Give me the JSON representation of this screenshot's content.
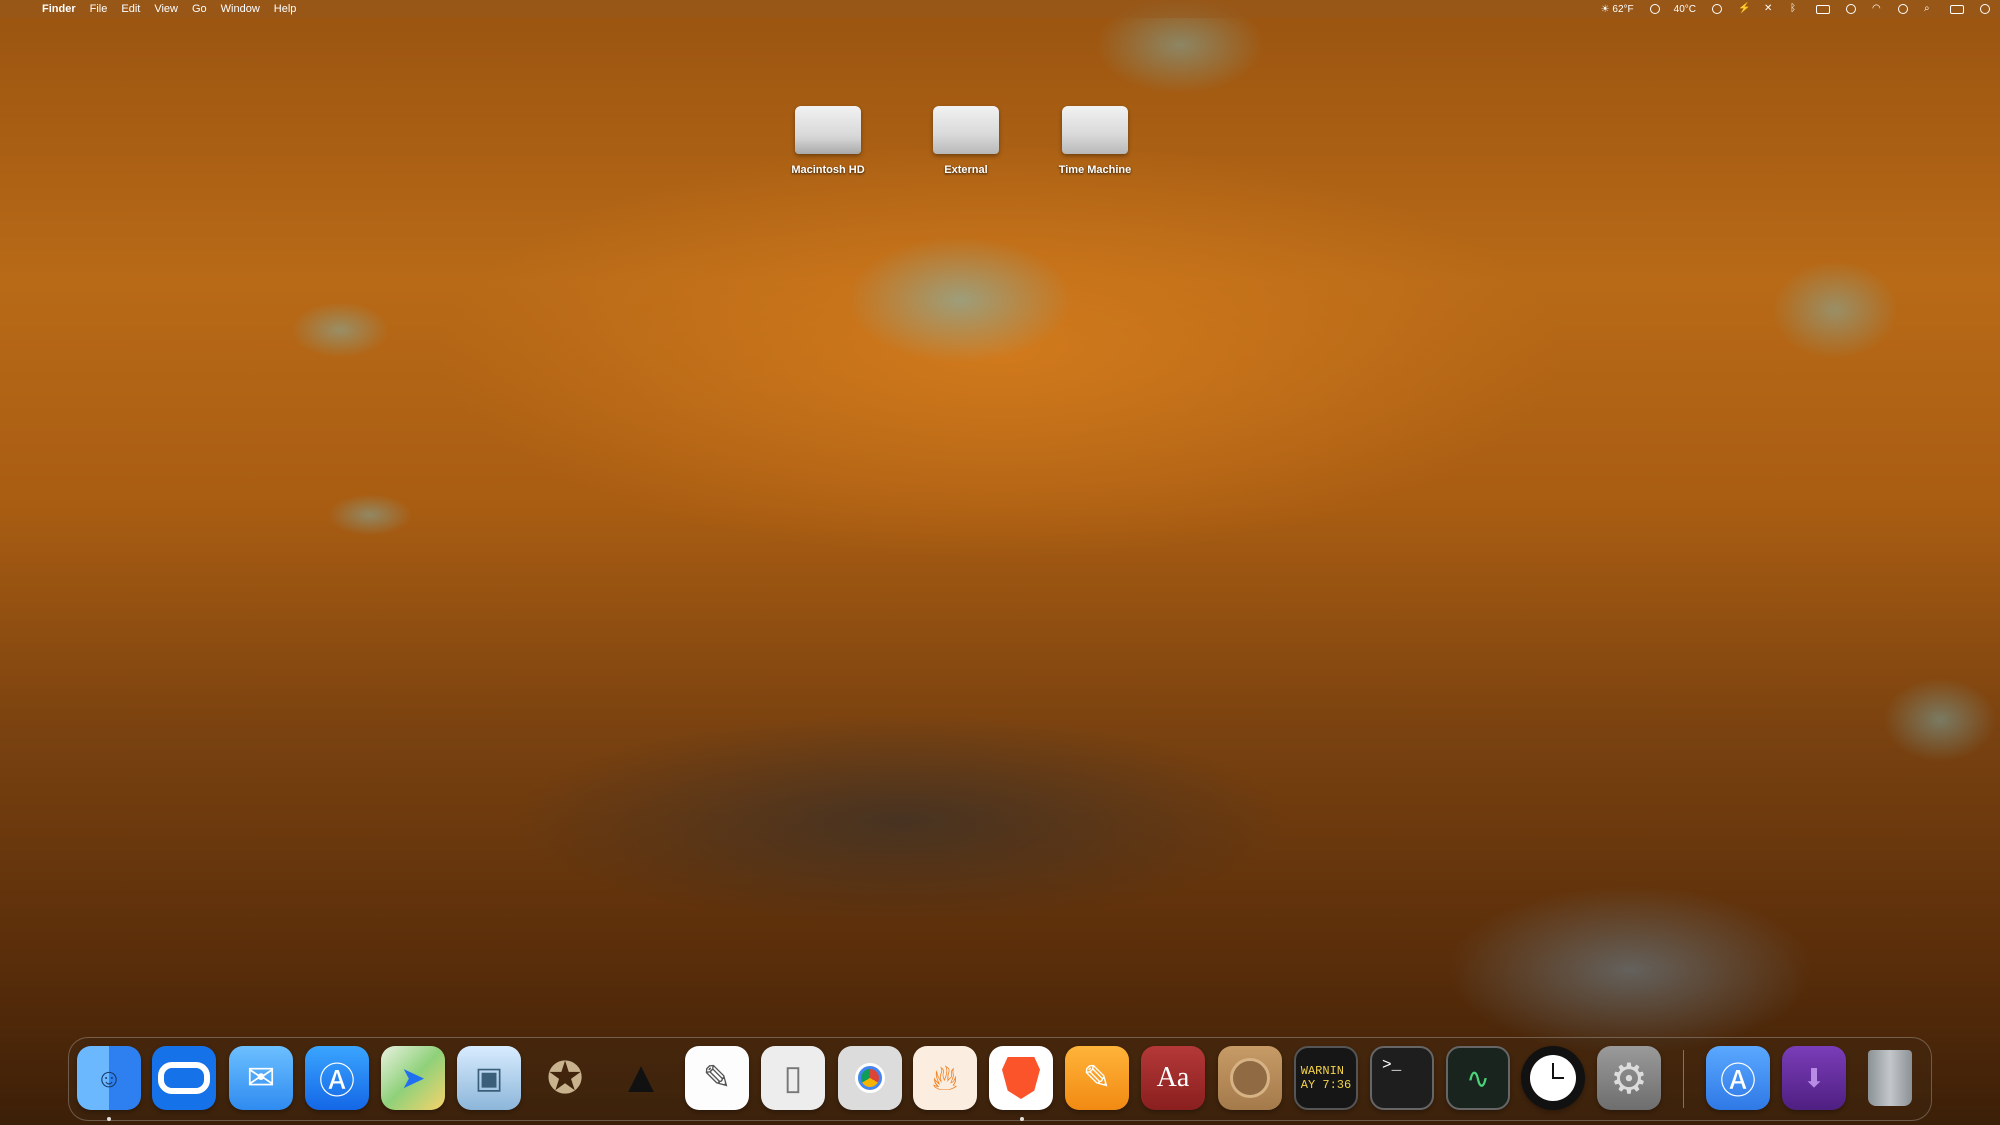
{
  "menubar": {
    "app_name": "Finder",
    "menus": [
      "File",
      "Edit",
      "View",
      "Go",
      "Window",
      "Help"
    ],
    "weather": "☀ 62°F",
    "temperature": "40°C"
  },
  "desktop": {
    "disks": [
      {
        "label": "Macintosh HD",
        "icon": "macintosh-hd-icon"
      },
      {
        "label": "External",
        "icon": "external-drive-icon"
      },
      {
        "label": "Time Machine",
        "icon": "time-machine-drive-icon"
      }
    ]
  },
  "dock": {
    "console_text": "WARNIN\nAY 7:36",
    "dictionary_text": "Aa",
    "apps": [
      {
        "name": "Finder",
        "icon": "finder-icon",
        "color": "#3e8ef3"
      },
      {
        "name": "Oracle",
        "icon": "oval-icon",
        "color": "#1672e8"
      },
      {
        "name": "Mail",
        "icon": "mail-icon",
        "color": "#4aa3f5"
      },
      {
        "name": "App Store",
        "icon": "app-store-icon",
        "color": "#1b84f2"
      },
      {
        "name": "Maps",
        "icon": "maps-icon",
        "color": "#6cc36a"
      },
      {
        "name": "Preview",
        "icon": "preview-icon",
        "color": "#9ec7e8"
      },
      {
        "name": "GIMP",
        "icon": "gimp-icon",
        "color": "#d6c3a3"
      },
      {
        "name": "Inkscape",
        "icon": "inkscape-icon",
        "color": "#f2f2f2"
      },
      {
        "name": "TextEdit",
        "icon": "textedit-icon",
        "color": "#ffffff"
      },
      {
        "name": "Files",
        "icon": "file-icon",
        "color": "#ececec"
      },
      {
        "name": "Chrome Apps",
        "icon": "chrome-apps-icon",
        "color": "#d9d9d9"
      },
      {
        "name": "Ember",
        "icon": "flame-icon",
        "color": "#fbeee0"
      },
      {
        "name": "Brave",
        "icon": "brave-icon",
        "color": "#ffffff"
      },
      {
        "name": "Pages",
        "icon": "pencil-icon",
        "color": "#f6a21c"
      },
      {
        "name": "Dictionary",
        "icon": "dictionary-icon",
        "color": "#a02b2b"
      },
      {
        "name": "Contacts",
        "icon": "contacts-icon",
        "color": "#b88e5d"
      },
      {
        "name": "Console",
        "icon": "console-icon",
        "color": "#1e1e1e"
      },
      {
        "name": "Terminal",
        "icon": "terminal-icon",
        "color": "#1e1e1e"
      },
      {
        "name": "Activity Monitor",
        "icon": "activity-monitor-icon",
        "color": "#1c2a22"
      },
      {
        "name": "Clock",
        "icon": "clock-icon",
        "color": "#1a1a1a"
      },
      {
        "name": "System Settings",
        "icon": "settings-icon",
        "color": "#8c8c8c"
      },
      {
        "name": "Applications",
        "icon": "applications-folder-icon",
        "color": "#3d8cf0"
      },
      {
        "name": "Downloads",
        "icon": "downloads-folder-icon",
        "color": "#5a2a8a"
      },
      {
        "name": "Trash",
        "icon": "trash-icon",
        "color": "#9fa4a8"
      }
    ]
  }
}
